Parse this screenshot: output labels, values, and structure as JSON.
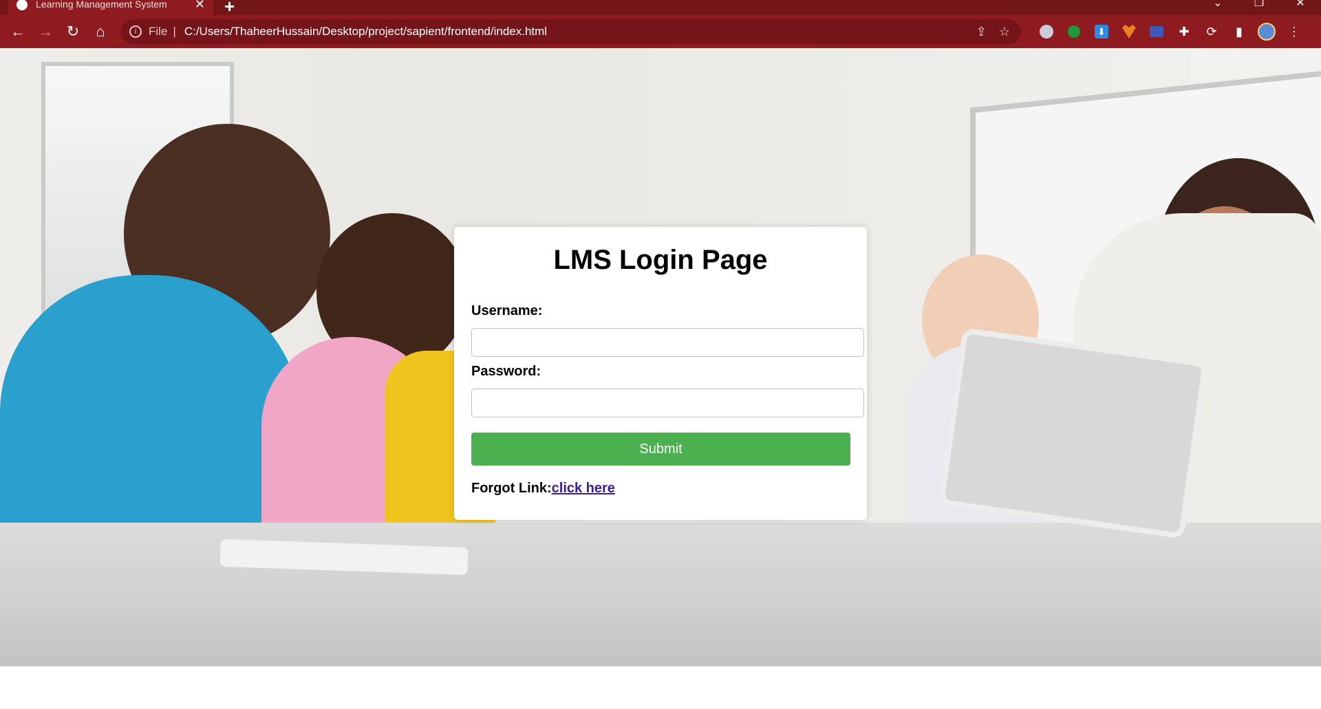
{
  "browser": {
    "tab_title": "Learning Management System",
    "address_scheme": "File",
    "address_url": "C:/Users/ThaheerHussain/Desktop/project/sapient/frontend/index.html"
  },
  "login": {
    "title": "LMS Login Page",
    "username_label": "Username:",
    "username_value": "",
    "password_label": "Password:",
    "password_value": "",
    "submit_label": "Submit",
    "forgot_label": "Forgot Link:",
    "forgot_link": "click here"
  },
  "colors": {
    "chrome": "#8e1b20",
    "submit": "#4caf50",
    "link": "#3a2090"
  }
}
